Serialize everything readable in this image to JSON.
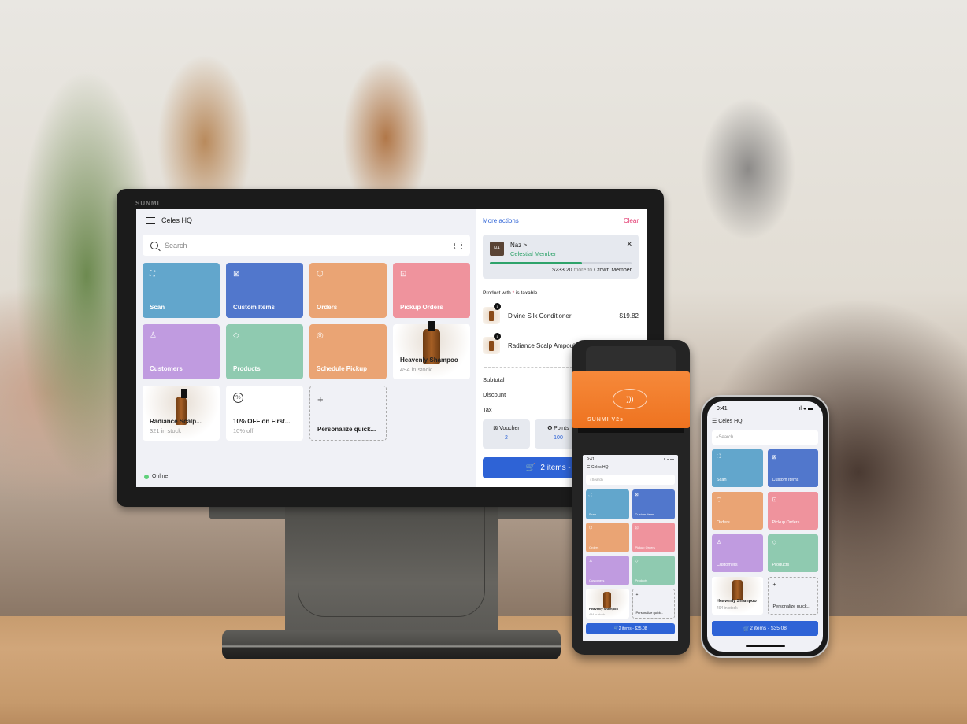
{
  "colors": {
    "scan": "#62a6cc",
    "custom_items": "#5177cc",
    "orders": "#eaa474",
    "pickup_orders": "#ef939d",
    "customers": "#c09be0",
    "products": "#8fcab0",
    "schedule_pickup": "#eaa474",
    "accent_blue": "#2e63d6",
    "clear_red": "#e2336b",
    "member_green": "#2ea36a",
    "online_green": "#5fd07a"
  },
  "monitor": {
    "brand": "SUNMI",
    "header": {
      "title": "Celes HQ",
      "menu_icon": "hamburger-icon"
    },
    "search": {
      "placeholder": "Search",
      "icon": "search-icon",
      "scan_icon": "barcode-scan-icon"
    },
    "tiles": [
      {
        "label": "Scan",
        "icon": "⛶",
        "type": "action"
      },
      {
        "label": "Custom Items",
        "icon": "⊠",
        "type": "action"
      },
      {
        "label": "Orders",
        "icon": "⬡",
        "type": "action"
      },
      {
        "label": "Pickup Orders",
        "icon": "⊡",
        "type": "action"
      },
      {
        "label": "Customers",
        "icon": "♙",
        "type": "action"
      },
      {
        "label": "Products",
        "icon": "◇",
        "type": "action"
      },
      {
        "label": "Schedule Pickup",
        "icon": "◎",
        "type": "action"
      },
      {
        "label": "Heavenly Shampoo",
        "sub": "494 in stock",
        "type": "product"
      },
      {
        "label": "Radiance Scalp...",
        "sub": "321 in stock",
        "type": "product"
      },
      {
        "label": "10% OFF on First...",
        "sub": "10% off",
        "icon": "%",
        "type": "discount"
      },
      {
        "label": "Personalize quick...",
        "icon": "+",
        "type": "add"
      }
    ],
    "status": "Online",
    "cart": {
      "more_actions": "More actions",
      "clear": "Clear",
      "member": {
        "initials": "NA",
        "name": "Naz >",
        "tier": "Celestial Member",
        "progress": 0.65,
        "amount": "$233.20",
        "note_mid": "more to",
        "next_tier": "Crown Member"
      },
      "tax_note_pre": "Product with",
      "tax_note_star": "*",
      "tax_note_post": "is taxable",
      "items": [
        {
          "name": "Divine Silk Conditioner",
          "price": "$19.82",
          "qty": "1"
        },
        {
          "name": "Radiance Scalp Ampoule",
          "price": "",
          "qty": "1"
        }
      ],
      "summary": [
        "Subtotal",
        "Discount",
        "Tax"
      ],
      "voucher": {
        "label": "Voucher",
        "value": "2"
      },
      "points": {
        "label": "Points",
        "value": "100"
      },
      "checkout": "2 items - $35.08"
    }
  },
  "handheld": {
    "brand": "SUNMI V2s",
    "time": "9:41",
    "title": "Celes HQ",
    "search": "Search",
    "tiles": [
      {
        "label": "Scan",
        "icon": "⛶"
      },
      {
        "label": "Custom Items",
        "icon": "⊠"
      },
      {
        "label": "Orders",
        "icon": "⬡"
      },
      {
        "label": "Pickup Orders",
        "icon": "⊡"
      },
      {
        "label": "Customers",
        "icon": "♙"
      },
      {
        "label": "Products",
        "icon": "◇"
      }
    ],
    "product": {
      "label": "Heavenly Shampoo",
      "sub": "494 in stock"
    },
    "add": "Personalize quick...",
    "checkout": "2 items - $35.08"
  },
  "phone": {
    "time": "9:41",
    "status_icons": "signal wifi battery",
    "title": "Celes HQ",
    "search": "Search",
    "tiles": [
      {
        "label": "Scan",
        "icon": "⛶"
      },
      {
        "label": "Custom Items",
        "icon": "⊠"
      },
      {
        "label": "Orders",
        "icon": "⬡"
      },
      {
        "label": "Pickup Orders",
        "icon": "⊡"
      },
      {
        "label": "Customers",
        "icon": "♙"
      },
      {
        "label": "Products",
        "icon": "◇"
      }
    ],
    "product": {
      "label": "Heavenly Shampoo",
      "sub": "494 in stock"
    },
    "add": "Personalize quick...",
    "checkout": "2 items - $35.08"
  }
}
